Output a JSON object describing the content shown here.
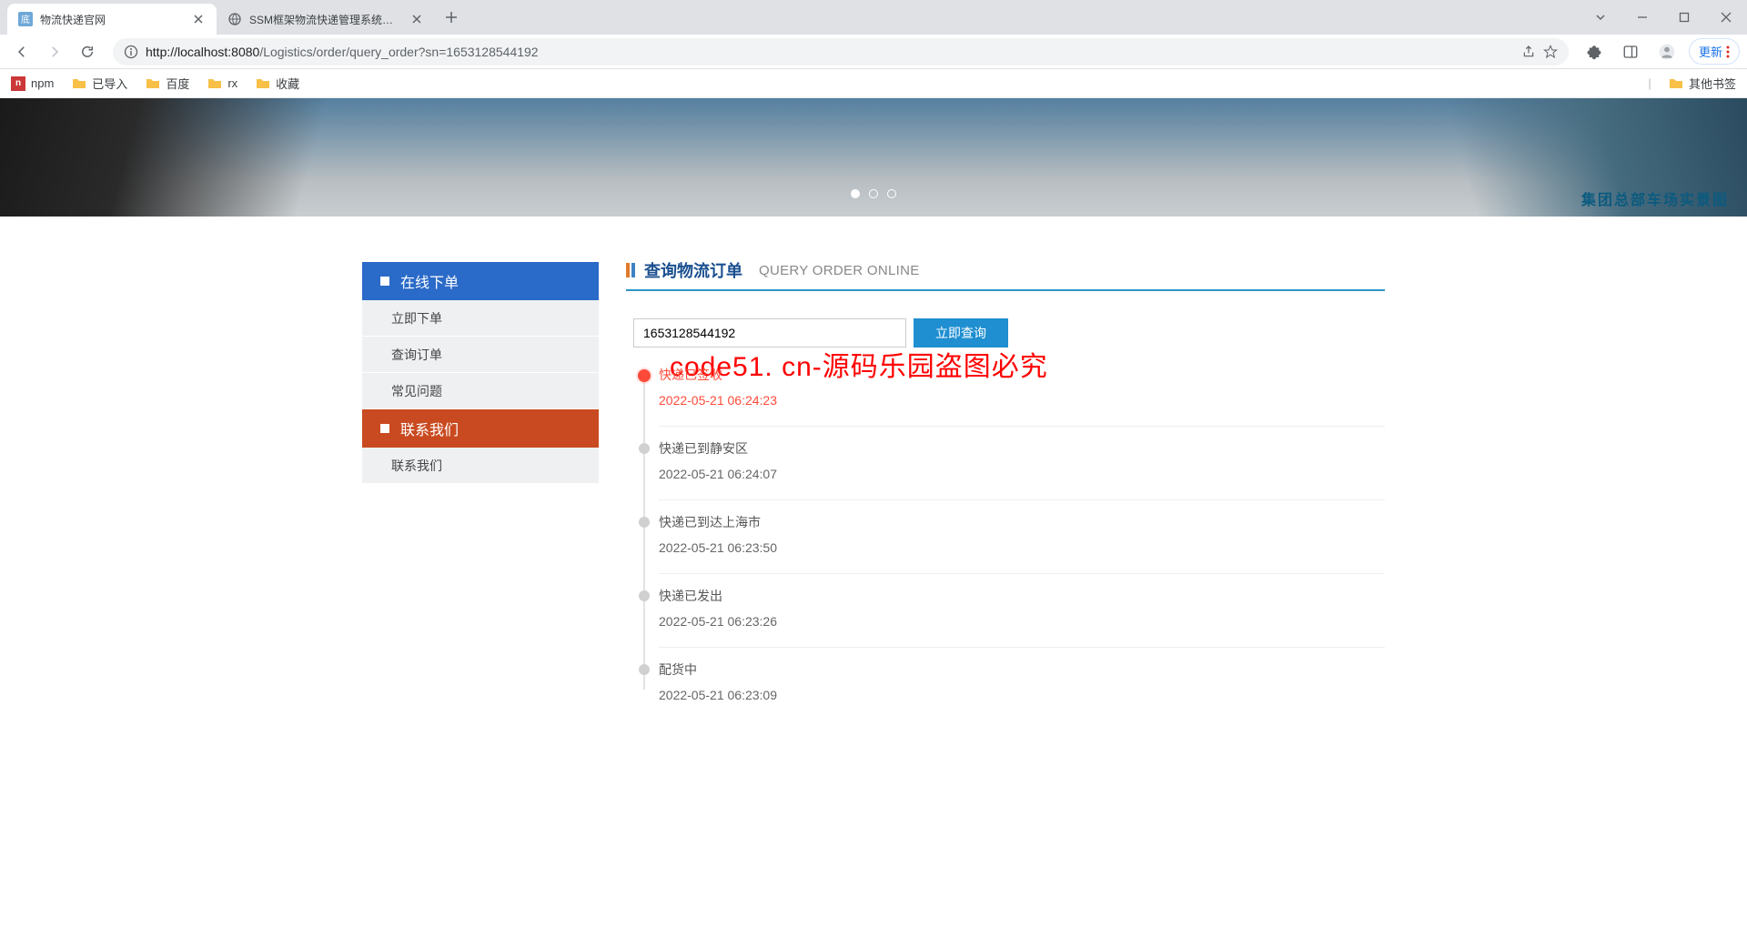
{
  "browser": {
    "tabs": [
      {
        "title": "物流快递官网",
        "active": true
      },
      {
        "title": "SSM框架物流快递管理系统后台",
        "active": false
      }
    ],
    "url_host": "http://localhost:8080",
    "url_path": "/Logistics/order/query_order?sn=1653128544192",
    "update_label": "更新",
    "bookmarks": [
      {
        "label": "npm",
        "type": "npm"
      },
      {
        "label": "已导入",
        "type": "folder"
      },
      {
        "label": "百度",
        "type": "folder"
      },
      {
        "label": "rx",
        "type": "folder"
      },
      {
        "label": "收藏",
        "type": "folder"
      }
    ],
    "other_bookmarks": "其他书签"
  },
  "banner_caption": "集团总部车场实景图",
  "sidebar": {
    "group1_title": "在线下单",
    "group1_items": [
      "立即下单",
      "查询订单",
      "常见问题"
    ],
    "group2_title": "联系我们",
    "group2_items": [
      "联系我们"
    ]
  },
  "section": {
    "title": "查询物流订单",
    "subtitle": "QUERY ORDER ONLINE"
  },
  "query": {
    "value": "1653128544192",
    "button": "立即查询"
  },
  "watermark": "code51. cn-源码乐园盗图必究",
  "timeline": [
    {
      "text": "快递已签收",
      "time": "2022-05-21 06:24:23",
      "current": true
    },
    {
      "text": "快递已到静安区",
      "time": "2022-05-21 06:24:07",
      "current": false
    },
    {
      "text": "快递已到达上海市",
      "time": "2022-05-21 06:23:50",
      "current": false
    },
    {
      "text": "快递已发出",
      "time": "2022-05-21 06:23:26",
      "current": false
    },
    {
      "text": "配货中",
      "time": "2022-05-21 06:23:09",
      "current": false
    }
  ]
}
